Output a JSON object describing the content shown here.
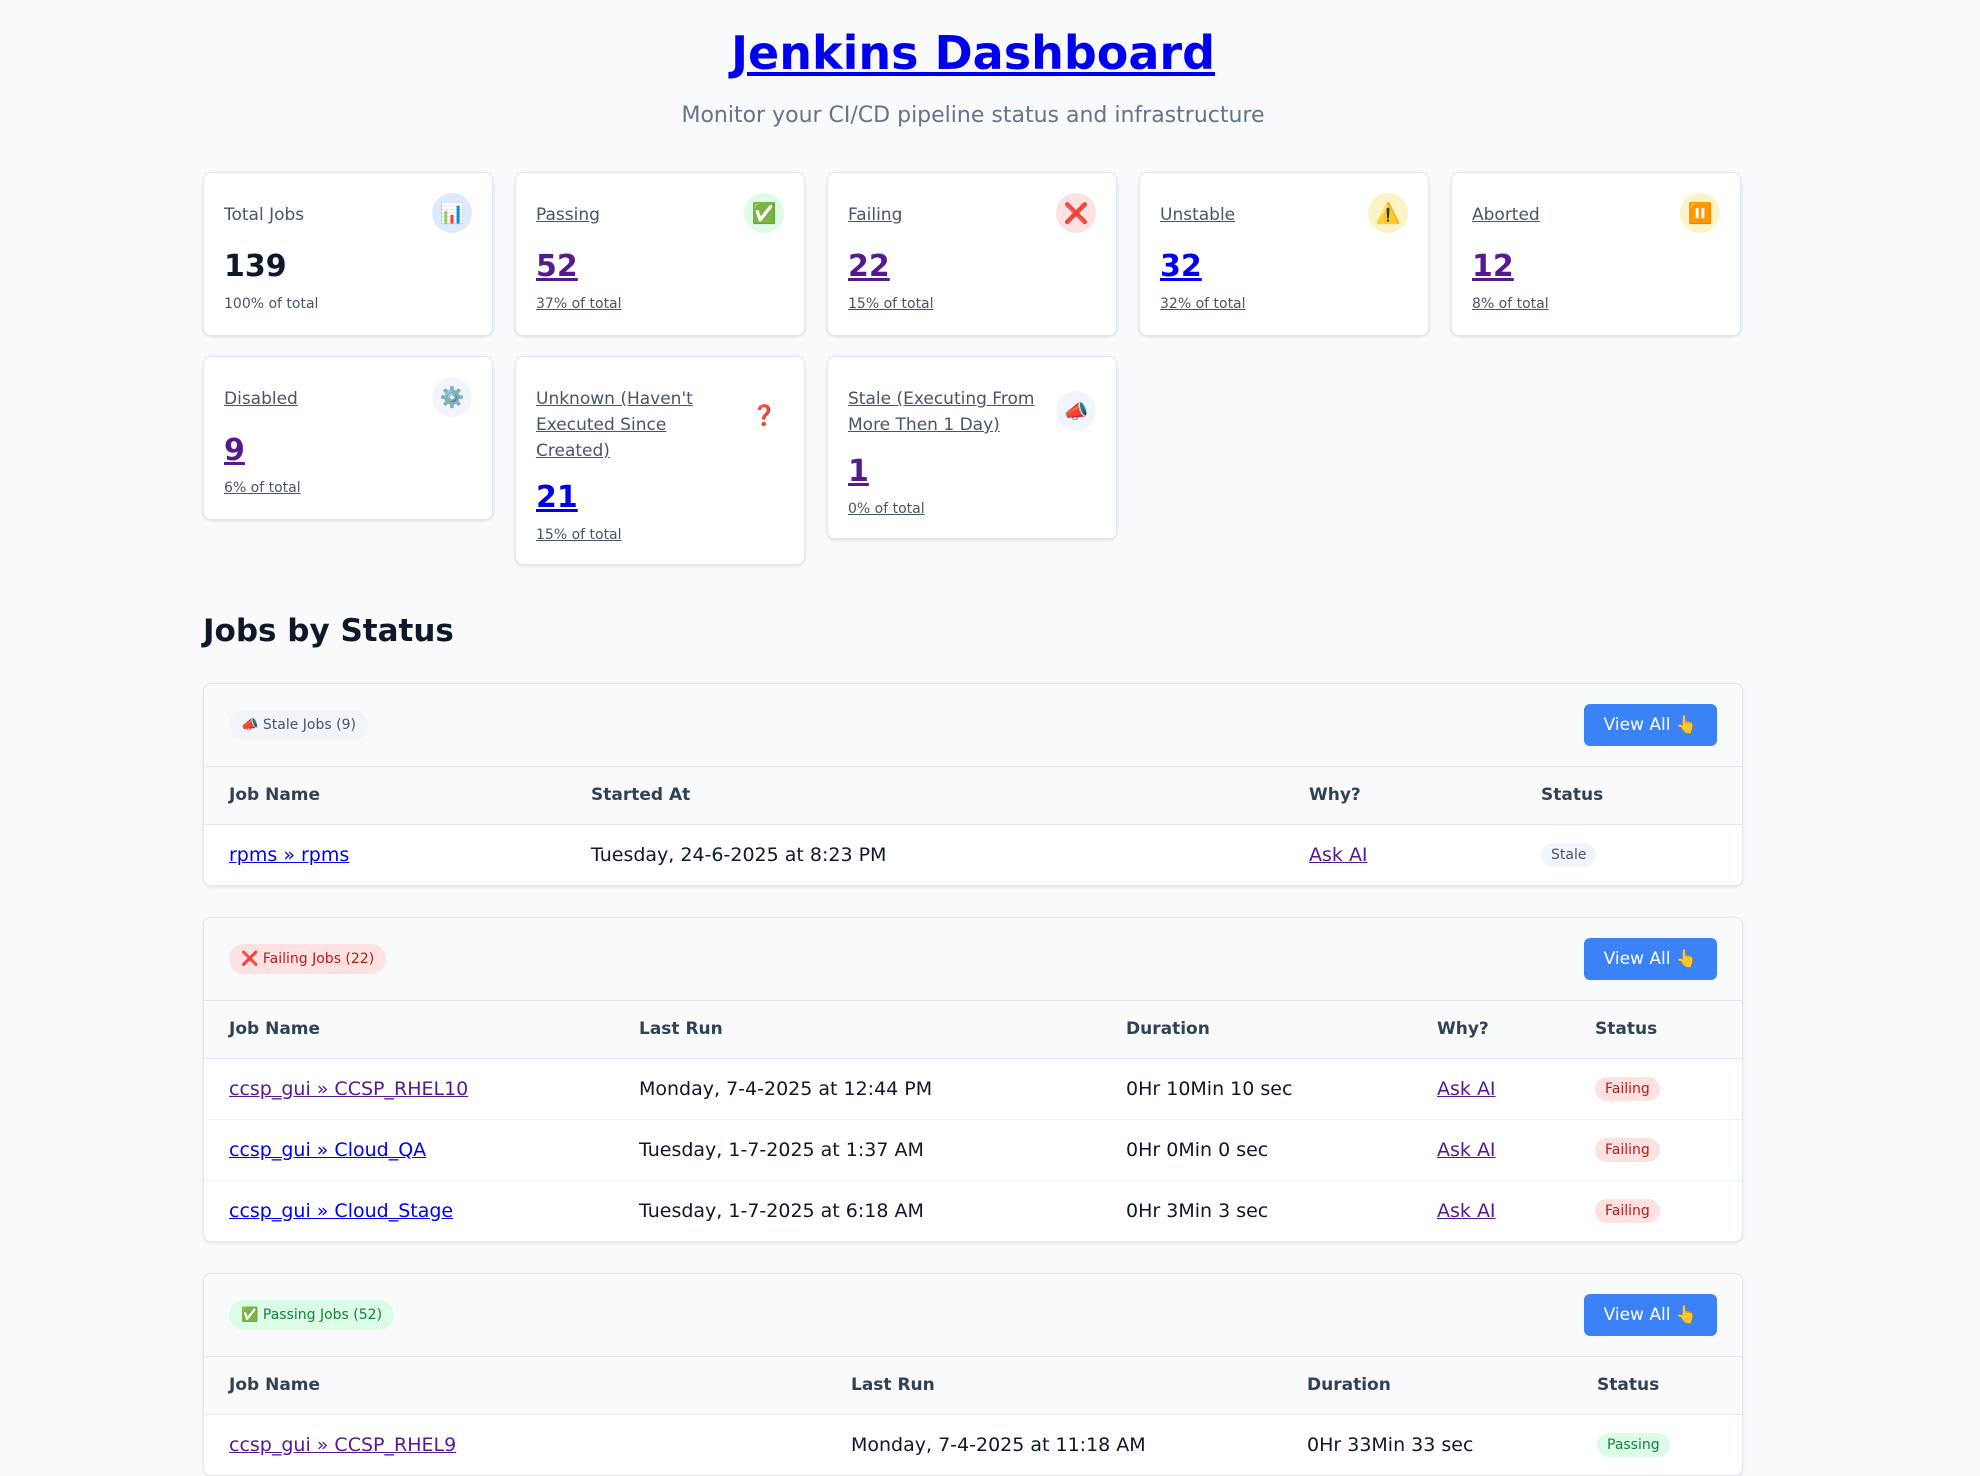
{
  "header": {
    "title": "Jenkins Dashboard",
    "subtitle": "Monitor your CI/CD pipeline status and infrastructure"
  },
  "stats": [
    {
      "label": "Total Jobs",
      "value": "139",
      "pct": "100% of total",
      "icon": "chart-icon",
      "glyph": "📊",
      "icon_bg": "#dbeafe"
    },
    {
      "label": "Passing",
      "value": "52",
      "pct": "37% of total",
      "icon": "check-icon",
      "glyph": "✅",
      "icon_bg": "#dcfce7"
    },
    {
      "label": "Failing",
      "value": "22",
      "pct": "15% of total",
      "icon": "cross-icon",
      "glyph": "❌",
      "icon_bg": "#fee2e2"
    },
    {
      "label": "Unstable",
      "value": "32",
      "pct": "32% of total",
      "icon": "warning-icon",
      "glyph": "⚠️",
      "icon_bg": "#fef3c7"
    },
    {
      "label": "Aborted",
      "value": "12",
      "pct": "8% of total",
      "icon": "pause-icon",
      "glyph": "⏸️",
      "icon_bg": "#fef3c7"
    },
    {
      "label": "Disabled",
      "value": "9",
      "pct": "6% of total",
      "icon": "gear-icon",
      "glyph": "⚙️",
      "icon_bg": "#f1f5f9"
    },
    {
      "label": "Unknown (Haven't Executed Since Created)",
      "value": "21",
      "pct": "15% of total",
      "icon": "question-icon",
      "glyph": "❓",
      "icon_bg": "transparent"
    },
    {
      "label": "Stale (Executing From More Then 1 Day)",
      "value": "1",
      "pct": "0% of total",
      "icon": "megaphone-icon",
      "glyph": "📣",
      "icon_bg": "#f1f5f9"
    }
  ],
  "section_title": "Jobs by Status",
  "stale_panel": {
    "pill": "📣 Stale Jobs (9)",
    "button": "View All 👆",
    "columns": [
      "Job Name",
      "Started At",
      "Why?",
      "Status"
    ],
    "rows": [
      {
        "job": "rpms » rpms",
        "started": "Tuesday, 24-6-2025 at 8:23 PM",
        "why": "Ask AI",
        "status": "Stale"
      }
    ]
  },
  "failing_panel": {
    "pill": "❌ Failing Jobs (22)",
    "button": "View All 👆",
    "columns": [
      "Job Name",
      "Last Run",
      "Duration",
      "Why?",
      "Status"
    ],
    "rows": [
      {
        "job": "ccsp_gui » CCSP_RHEL10",
        "last_run": "Monday, 7-4-2025 at 12:44 PM",
        "duration": "0Hr 10Min 10 sec",
        "why": "Ask AI",
        "status": "Failing"
      },
      {
        "job": "ccsp_gui » Cloud_QA",
        "last_run": "Tuesday, 1-7-2025 at 1:37 AM",
        "duration": "0Hr 0Min 0 sec",
        "why": "Ask AI",
        "status": "Failing"
      },
      {
        "job": "ccsp_gui » Cloud_Stage",
        "last_run": "Tuesday, 1-7-2025 at 6:18 AM",
        "duration": "0Hr 3Min 3 sec",
        "why": "Ask AI",
        "status": "Failing"
      }
    ]
  },
  "passing_panel": {
    "pill": "✅ Passing Jobs (52)",
    "button": "View All 👆",
    "columns": [
      "Job Name",
      "Last Run",
      "Duration",
      "Status"
    ],
    "rows": [
      {
        "job": "ccsp_gui » CCSP_RHEL9",
        "last_run": "Monday, 7-4-2025 at 11:18 AM",
        "duration": "0Hr 33Min 33 sec",
        "status": "Passing"
      }
    ]
  }
}
